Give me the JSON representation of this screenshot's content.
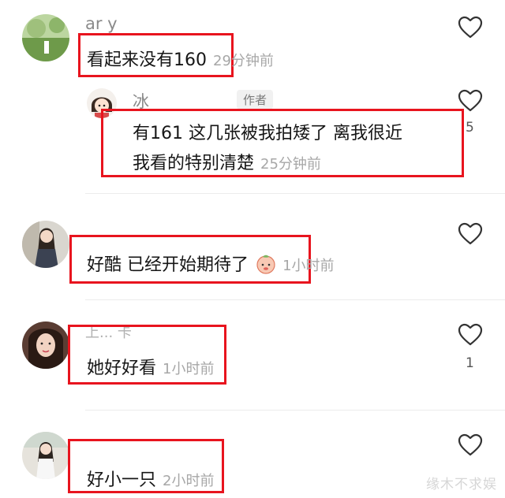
{
  "comments": [
    {
      "username": "ar                    y",
      "text": "看起来没有160",
      "time": "29分钟前",
      "like_count": "",
      "reply": {
        "username": "冰",
        "badge": "作者",
        "text_line1": "有161 这几张被我拍矮了  离我很近",
        "text_line2": "我看的特别清楚",
        "time": "25分钟前",
        "like_count": "5"
      }
    },
    {
      "username": "",
      "text": "好酷  已经开始期待了",
      "emoji": "peach-emoji-icon",
      "time": "1小时前",
      "like_count": ""
    },
    {
      "username": "上...  卡",
      "text": "她好好看",
      "time": "1小时前",
      "like_count": "1"
    },
    {
      "username": "",
      "text": "好小一只",
      "time": "2小时前",
      "like_count": ""
    }
  ],
  "watermark": "缘木不求娱",
  "colors": {
    "highlight_box": "#e8141e",
    "text": "#161616",
    "meta": "#a7a7a7"
  }
}
